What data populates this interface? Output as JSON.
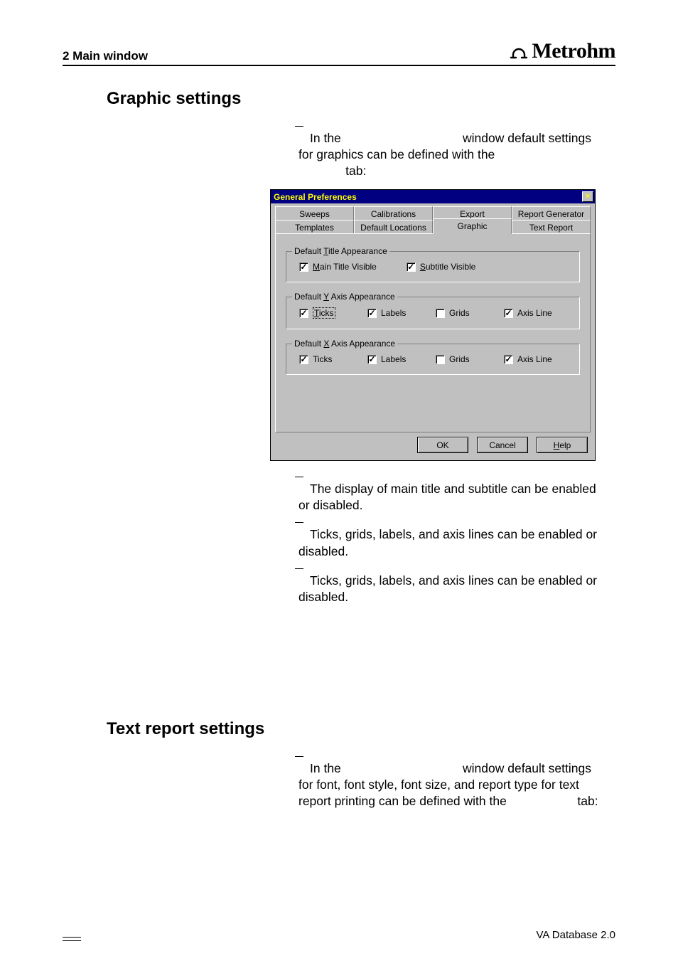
{
  "header": {
    "chapter": "2  Main window",
    "brand": "Metrohm"
  },
  "section1": {
    "title": "Graphic settings",
    "intro_pre": "In the ",
    "intro_post": " window default settings for graphics can be defined with the ",
    "intro_end": " tab:"
  },
  "dialog": {
    "title": "General Preferences",
    "tabs_row1": [
      "Sweeps",
      "Calibrations",
      "Export",
      "Report Generator"
    ],
    "tabs_row2": [
      "Templates",
      "Default Locations",
      "Graphic",
      "Text Report"
    ],
    "group_title": {
      "legend_pre": "Default ",
      "legend_u": "T",
      "legend_post": "itle Appearance",
      "cb1_u": "M",
      "cb1_post": "ain Title Visible",
      "cb2_u": "S",
      "cb2_post": "ubtitle Visible"
    },
    "group_y": {
      "legend_pre": "Default ",
      "legend_u": "Y",
      "legend_post": " Axis Appearance",
      "cb1_u": "T",
      "cb1_post": "icks",
      "cb2": "Labels",
      "cb3": "Grids",
      "cb4": "Axis Line"
    },
    "group_x": {
      "legend_pre": "Default ",
      "legend_u": "X",
      "legend_post": " Axis Appearance",
      "cb1": "Ticks",
      "cb2": "Labels",
      "cb3": "Grids",
      "cb4": "Axis Line"
    },
    "buttons": {
      "ok": "OK",
      "cancel": "Cancel",
      "help_u": "H",
      "help_post": "elp"
    }
  },
  "desc": {
    "title_text": "The display of main title and subtitle can be enabled or disabled.",
    "y_text": "Ticks, grids, labels, and axis lines can be enabled or disabled.",
    "x_text": "Ticks, grids, labels, and axis lines can be enabled or disabled."
  },
  "section2": {
    "title": "Text report settings",
    "intro_pre": "In the ",
    "intro_mid": " window default settings for font, font style, font size, and report type for text report printing can be defined with the ",
    "intro_end": " tab:"
  },
  "footer": {
    "right": "VA Database 2.0"
  }
}
